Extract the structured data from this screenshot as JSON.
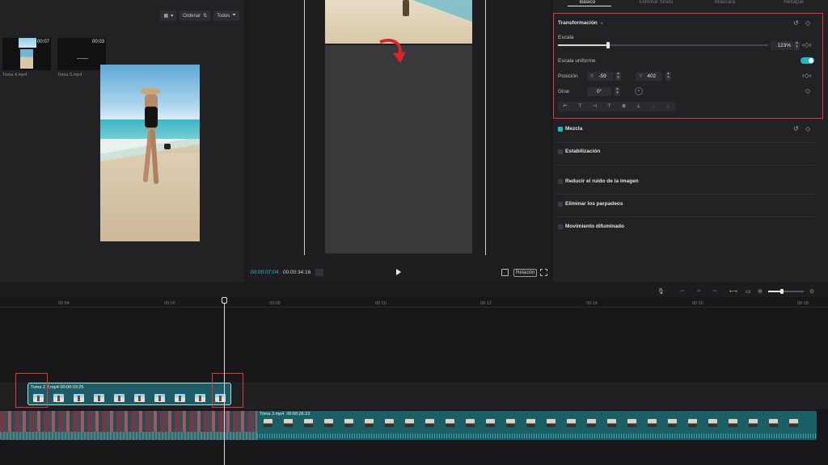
{
  "media": {
    "sort_label": "Ordenar",
    "filter_label": "Todos",
    "clips": [
      {
        "name": "Toma 4.mp4",
        "duration": "00:07"
      },
      {
        "name": "Toma 5.mp4",
        "duration": "00:03"
      }
    ]
  },
  "preview": {
    "current_time": "00:00:07:04",
    "total_time": "00:00:34:16",
    "ratio_label": "Relación"
  },
  "inspector": {
    "tabs": [
      "Básico",
      "Eliminar fondo",
      "Máscara",
      "Retoque"
    ],
    "active_tab": "Básico",
    "transform_title": "Transformación",
    "scale_label": "Escala",
    "scale_value": "123%",
    "scale_fraction": 0.24,
    "uniform_label": "Escala uniforme",
    "uniform_on": true,
    "position_label": "Posición",
    "pos_x_prefix": "X",
    "pos_x": "-59",
    "pos_y_prefix": "Y",
    "pos_y": "402",
    "rotate_label": "Girar",
    "rotate_value": "0°",
    "sections": [
      {
        "label": "Mezcla",
        "checked": true
      },
      {
        "label": "Estabilización",
        "checked": false
      },
      {
        "label": "Reducir el ruido de la imagen",
        "checked": false
      },
      {
        "label": "Eliminar los parpadeos",
        "checked": false
      },
      {
        "label": "Movimiento difuminado",
        "checked": false
      }
    ],
    "accent": "#22b5c3"
  },
  "timeline": {
    "ruler": [
      "00:04",
      "00:06",
      "00:08",
      "00:10",
      "00:12",
      "00:14",
      "00:16",
      "00:18"
    ],
    "overlay_clip": {
      "name": "Toma 2",
      "file": "2.mp4",
      "duration": "00:00:03:25"
    },
    "main_clip_b": {
      "name": "Toma 3.mp4",
      "duration": "00:00:26:23"
    },
    "zoom_fraction": 0.35,
    "highlight_color": "#e0363f"
  }
}
